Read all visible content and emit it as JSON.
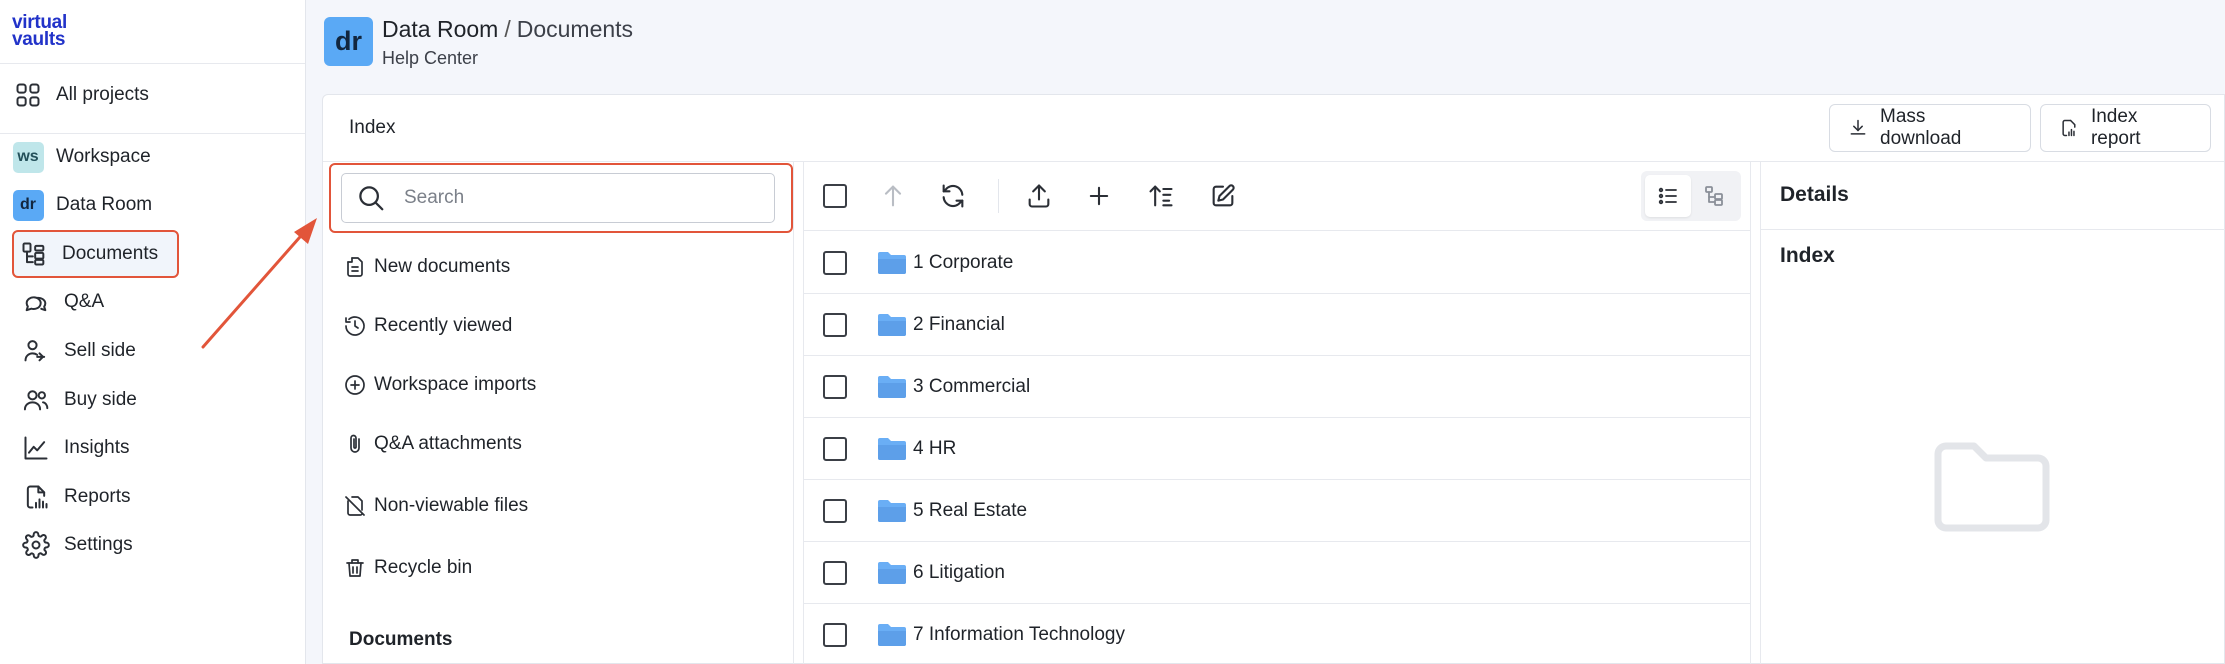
{
  "brand": {
    "logo_line1": "virtual",
    "logo_line2": "vaults"
  },
  "sidebar": {
    "items": [
      {
        "label": "All projects",
        "icon": "grid-icon"
      },
      {
        "label": "Workspace",
        "badge": "ws"
      },
      {
        "label": "Data Room",
        "badge": "dr"
      },
      {
        "label": "Documents",
        "icon": "documents-tree-icon"
      },
      {
        "label": "Q&A",
        "icon": "chat-bubbles-icon"
      },
      {
        "label": "Sell side",
        "icon": "users-sell-icon"
      },
      {
        "label": "Buy side",
        "icon": "users-buy-icon"
      },
      {
        "label": "Insights",
        "icon": "trend-chart-icon"
      },
      {
        "label": "Reports",
        "icon": "report-doc-icon"
      },
      {
        "label": "Settings",
        "icon": "gear-icon"
      }
    ]
  },
  "header": {
    "badge": "dr",
    "crumb_project": "Data Room",
    "crumb_sep": "/",
    "crumb_current": "Documents",
    "subtitle": "Help Center"
  },
  "card": {
    "title": "Index",
    "mass_download": "Mass download",
    "index_report": "Index report"
  },
  "index_panel": {
    "search_placeholder": "Search",
    "items": [
      {
        "label": "New documents",
        "icon": "new-doc-icon"
      },
      {
        "label": "Recently viewed",
        "icon": "history-icon"
      },
      {
        "label": "Workspace imports",
        "icon": "plus-circle-icon"
      },
      {
        "label": "Q&A attachments",
        "icon": "paperclip-icon"
      },
      {
        "label": "Non-viewable files",
        "icon": "no-file-icon"
      },
      {
        "label": "Recycle bin",
        "icon": "trash-icon"
      }
    ],
    "section": "Documents"
  },
  "files": {
    "rows": [
      {
        "name": "1 Corporate"
      },
      {
        "name": "2 Financial"
      },
      {
        "name": "3 Commercial"
      },
      {
        "name": "4 HR"
      },
      {
        "name": "5 Real Estate"
      },
      {
        "name": "6 Litigation"
      },
      {
        "name": "7 Information Technology"
      }
    ]
  },
  "details": {
    "title": "Details",
    "subtitle": "Index"
  },
  "colors": {
    "accent_annotation": "#e2553a",
    "brand": "#2233c9",
    "folder": "#6aaef5",
    "badge_dr": "#5aa9f5",
    "badge_ws": "#bfe6ea"
  }
}
